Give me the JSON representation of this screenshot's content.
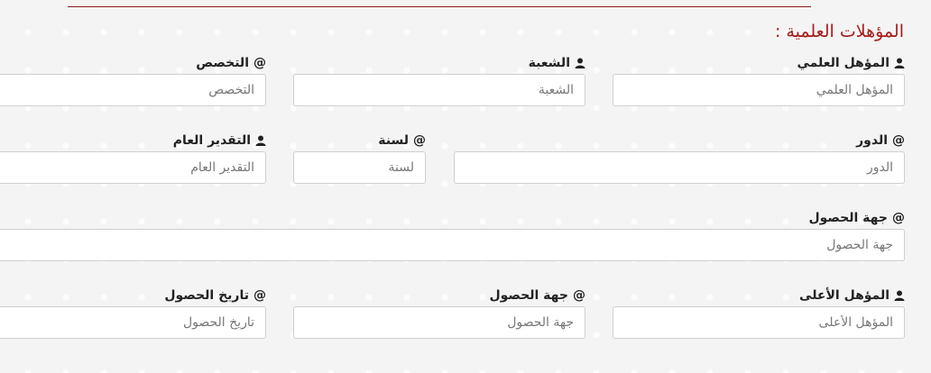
{
  "section": {
    "title": "المؤهلات العلمية :"
  },
  "fields": {
    "qualification": {
      "label": "المؤهل العلمي",
      "placeholder": "المؤهل العلمي",
      "icon": "user-icon"
    },
    "branch": {
      "label": "الشعبة",
      "placeholder": "الشعبة",
      "icon": "user-icon"
    },
    "specialization": {
      "label": "التخصص",
      "placeholder": "التخصص",
      "icon": "at-icon"
    },
    "round": {
      "label": "الدور",
      "placeholder": "الدور",
      "icon": "at-icon"
    },
    "year": {
      "label": "لسنة",
      "placeholder": "لسنة",
      "icon": "at-icon"
    },
    "overall_grade": {
      "label": "التقدير العام",
      "placeholder": "التقدير العام",
      "icon": "user-icon"
    },
    "issuer": {
      "label": "جهة الحصول",
      "placeholder": "جهة الحصول",
      "icon": "at-icon"
    },
    "higher_qualification": {
      "label": "المؤهل الأعلى",
      "placeholder": "المؤهل الأعلى",
      "icon": "user-icon"
    },
    "higher_issuer": {
      "label": "جهة الحصول",
      "placeholder": "جهة الحصول",
      "icon": "at-icon"
    },
    "obtain_date": {
      "label": "تاريخ الحصول",
      "placeholder": "تاريخ الحصول",
      "icon": "at-icon"
    }
  },
  "colors": {
    "accent": "#a51b1b",
    "rule": "#8b1a1a",
    "background": "#f4f4f4"
  }
}
